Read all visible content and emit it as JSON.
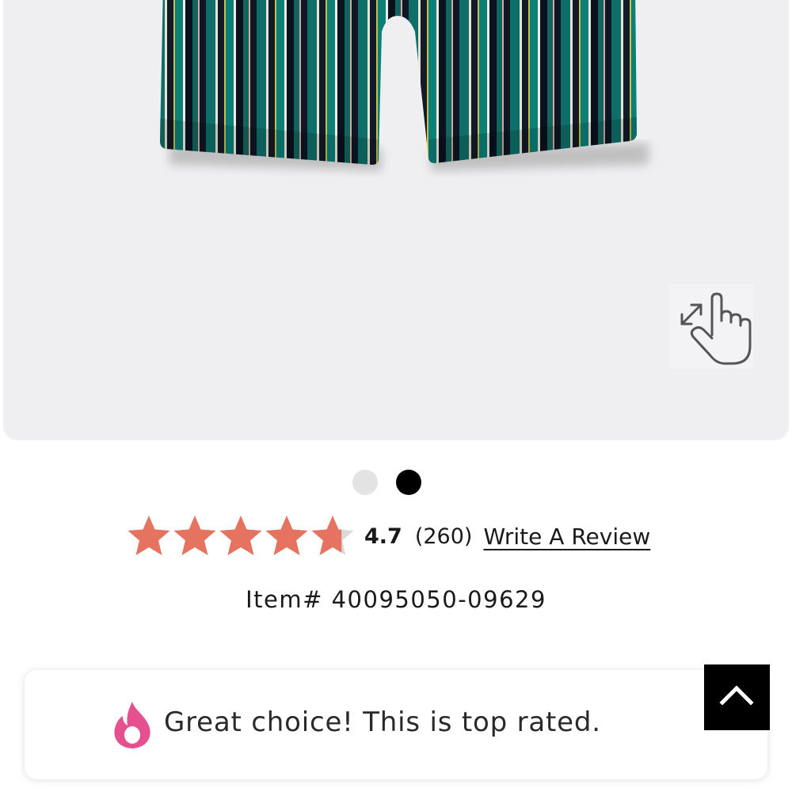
{
  "product": {
    "image_alt": "Striped boxer brief",
    "image_index": 2,
    "image_count": 2
  },
  "rating": {
    "value": 4.7,
    "value_label": "4.7",
    "max": 5,
    "count_label": "(260)",
    "write_review_label": "Write A Review",
    "star_color": "#e5735f",
    "star_empty_color": "#d9d9d9"
  },
  "item": {
    "number_label": "Item# 40095050-09629"
  },
  "banner": {
    "text": "Great choice! This is top rated.",
    "icon": "flame-icon",
    "icon_color": "#e5508f"
  },
  "controls": {
    "zoom_icon": "tap-to-zoom-icon",
    "back_to_top_icon": "chevron-up-icon"
  }
}
